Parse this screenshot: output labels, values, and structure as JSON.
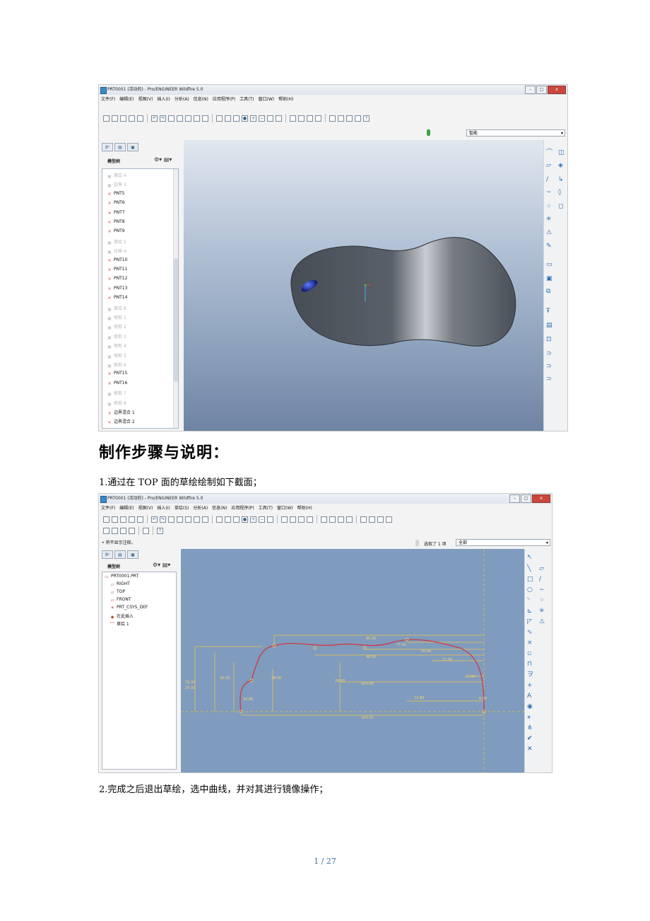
{
  "shot1": {
    "title": "PRT0001 (活动的) - Pro/ENGINEER Wildfire 5.0",
    "window_buttons": [
      "–",
      "□",
      "x"
    ],
    "menus": [
      "文件(F)",
      "编辑(E)",
      "视图(V)",
      "插入(I)",
      "分析(A)",
      "信息(N)",
      "应用程序(P)",
      "工具(T)",
      "窗口(W)",
      "帮助(H)"
    ],
    "filter_value": "智能",
    "tree_title": "模型树",
    "tree_items": [
      {
        "label": "草绘 4",
        "dim": true
      },
      {
        "label": "拉伸 3",
        "dim": true
      },
      {
        "label": "PNT5",
        "dim": false
      },
      {
        "label": "PNT6",
        "dim": false
      },
      {
        "label": "PNT7",
        "dim": false
      },
      {
        "label": "PNT8",
        "dim": false
      },
      {
        "label": "PNT9",
        "dim": false
      },
      {
        "label": "草绘 5",
        "dim": true
      },
      {
        "label": "拉伸 4",
        "dim": true
      },
      {
        "label": "PNT10",
        "dim": false
      },
      {
        "label": "PNT11",
        "dim": false
      },
      {
        "label": "PNT12",
        "dim": false
      },
      {
        "label": "PNT13",
        "dim": false
      },
      {
        "label": "PNT14",
        "dim": false
      },
      {
        "label": "草绘 6",
        "dim": true
      },
      {
        "label": "修剪 1",
        "dim": true
      },
      {
        "label": "修剪 2",
        "dim": true
      },
      {
        "label": "修剪 3",
        "dim": true
      },
      {
        "label": "修剪 4",
        "dim": true
      },
      {
        "label": "修剪 5",
        "dim": true
      },
      {
        "label": "修剪 6",
        "dim": true
      },
      {
        "label": "PNT15",
        "dim": false
      },
      {
        "label": "PNT16",
        "dim": false
      },
      {
        "label": "修剪 7",
        "dim": true
      },
      {
        "label": "修剪 8",
        "dim": true
      },
      {
        "label": "边界混合 1",
        "dim": false
      },
      {
        "label": "边界混合 2",
        "dim": false
      }
    ]
  },
  "heading": "制作步骤与说明：",
  "step1": "1.通过在 TOP 面的草绘绘制如下截面；",
  "shot2": {
    "title": "PRT0001 (活动的) - Pro/ENGINEER Wildfire 5.0",
    "window_buttons": [
      "–",
      "□",
      "x"
    ],
    "menus": [
      "文件(F)",
      "编辑(E)",
      "视图(V)",
      "插入(I)",
      "草绘(S)",
      "分析(A)",
      "信息(N)",
      "应用程序(P)",
      "工具(T)",
      "窗口(W)",
      "帮助(H)"
    ],
    "status_text": "• 将不显示注释。",
    "selected_text": "选取了 1 项",
    "filter_value": "全部",
    "tree_title": "模型树",
    "tree_items": [
      {
        "label": "PRT0001.PRT",
        "icon": "part"
      },
      {
        "label": "RIGHT",
        "icon": "plane"
      },
      {
        "label": "TOP",
        "icon": "plane"
      },
      {
        "label": "FRONT",
        "icon": "plane"
      },
      {
        "label": "PRT_CSYS_DEF",
        "icon": "csys"
      },
      {
        "label": "在此插入",
        "icon": "insert"
      },
      {
        "label": "草绘 1",
        "icon": "sketch"
      }
    ],
    "dims": [
      "95.00",
      "77.00",
      "50.00",
      "48.00",
      "12.00",
      "16.00",
      "25.00",
      "25.00",
      "28.00",
      "29.00",
      "103.00",
      "16.95",
      "12.80",
      "164.00",
      "6.00",
      "25.00"
    ]
  },
  "step2": "2.完成之后退出草绘，选中曲线，并对其进行镜像操作；",
  "footer": "1 / 27"
}
